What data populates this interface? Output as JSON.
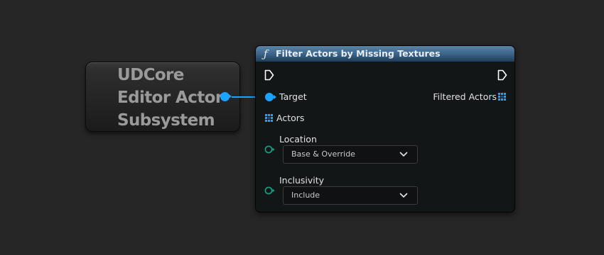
{
  "reference_node": {
    "title_lines": [
      "UDCore",
      "Editor Actor",
      "Subsystem"
    ]
  },
  "function_node": {
    "icon": "function-icon",
    "title": "Filter Actors by Missing Textures",
    "inputs": {
      "target_label": "Target",
      "actors_label": "Actors",
      "location_label": "Location",
      "location_value": "Base & Override",
      "inclusivity_label": "Inclusivity",
      "inclusivity_value": "Include"
    },
    "outputs": {
      "filtered_actors_label": "Filtered Actors"
    }
  },
  "colors": {
    "background": "#262626",
    "object_pin": "#1aa3ff",
    "enum_pin": "#16a085",
    "header": "#3a6186"
  }
}
